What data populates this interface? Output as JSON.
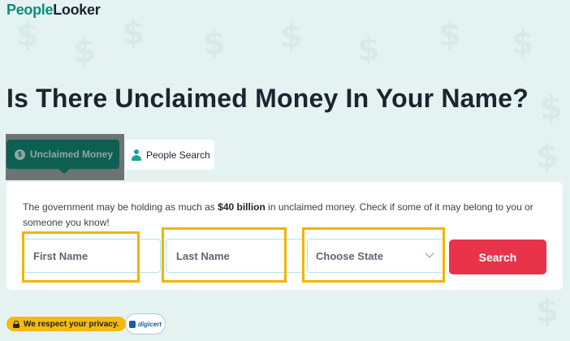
{
  "brand": {
    "logo_part1": "People",
    "logo_part2": "Looker"
  },
  "headline": "Is There Unclaimed Money In Your Name?",
  "tabs": [
    {
      "label": "Unclaimed Money",
      "icon": "dollar-coin-icon",
      "active": true
    },
    {
      "label": "People Search",
      "icon": "person-icon",
      "active": false
    }
  ],
  "description": {
    "before": "The government may be holding as much as ",
    "highlight": "$40 billion",
    "after": " in unclaimed money. Check if some of it may belong to you or someone you know!"
  },
  "form": {
    "first_name_placeholder": "First Name",
    "last_name_placeholder": "Last Name",
    "state_selected": "Choose State",
    "search_label": "Search"
  },
  "footer": {
    "privacy_label": "We respect your privacy.",
    "seal_label": "digicert"
  },
  "colors": {
    "accent": "#0f8c7a",
    "search_button": "#e8334a",
    "highlight_box": "#f0b400",
    "privacy_badge": "#f5b90f"
  },
  "background_icon": "dollar-sign-icon"
}
